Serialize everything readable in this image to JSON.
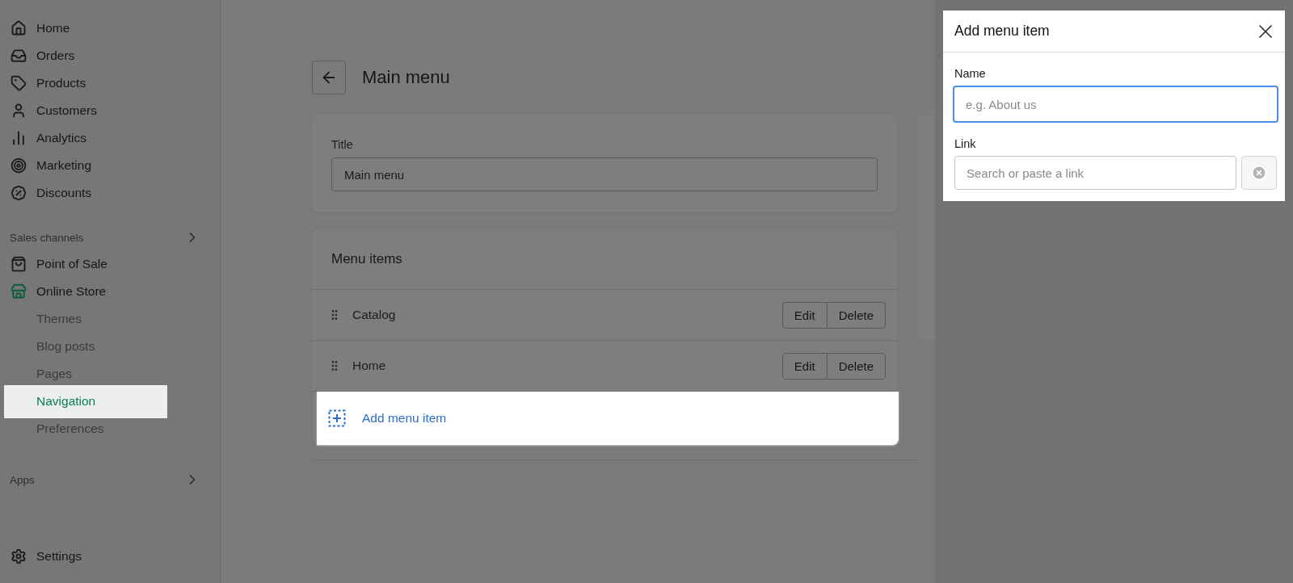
{
  "sidebar": {
    "groups": [
      {
        "items": [
          {
            "label": "Home",
            "selected": false
          },
          {
            "label": "Orders",
            "selected": false
          },
          {
            "label": "Products",
            "selected": false
          },
          {
            "label": "Customers",
            "selected": false
          },
          {
            "label": "Analytics",
            "selected": false
          },
          {
            "label": "Marketing",
            "selected": false
          },
          {
            "label": "Discounts",
            "selected": false
          }
        ]
      },
      {
        "heading": "Sales channels",
        "items": [
          {
            "label": "Point of Sale",
            "selected": false
          },
          {
            "label": "Online Store",
            "selected": false,
            "children": [
              {
                "label": "Themes",
                "selected": false
              },
              {
                "label": "Blog posts",
                "selected": false
              },
              {
                "label": "Pages",
                "selected": false
              },
              {
                "label": "Navigation",
                "selected": true
              },
              {
                "label": "Preferences",
                "selected": false
              }
            ]
          }
        ]
      },
      {
        "heading": "Apps"
      }
    ],
    "footer": {
      "label": "Settings",
      "selected": false
    }
  },
  "header": {
    "title": "Main menu"
  },
  "title_card": {
    "label": "Title",
    "value": "Main menu"
  },
  "menu_items": {
    "heading": "Menu items",
    "rows": [
      {
        "label": "Catalog",
        "actions": [
          "Edit",
          "Delete"
        ]
      },
      {
        "label": "Home",
        "actions": [
          "Edit",
          "Delete"
        ]
      }
    ],
    "add_label": "Add menu item"
  },
  "dialog": {
    "title": "Add menu item",
    "fields": [
      {
        "kind": "text",
        "label": "Name",
        "placeholder": "e.g. About us",
        "focused": true
      },
      {
        "kind": "link",
        "label": "Link",
        "placeholder": "Search or paste a link",
        "focused": false
      }
    ]
  }
}
